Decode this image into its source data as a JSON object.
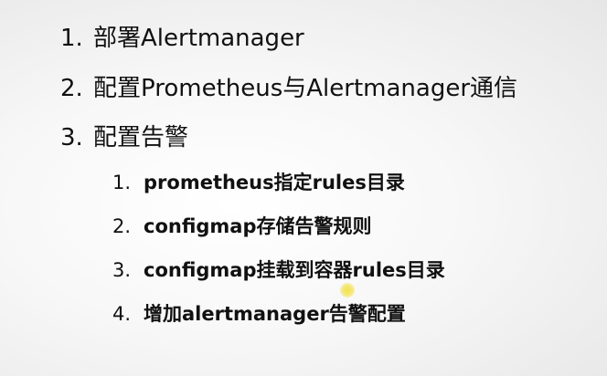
{
  "outline": {
    "items": [
      {
        "number": "1.",
        "text": "部署Alertmanager"
      },
      {
        "number": "2.",
        "text": "配置Prometheus与Alertmanager通信"
      },
      {
        "number": "3.",
        "text": "配置告警"
      }
    ],
    "subitems": [
      {
        "number": "1.",
        "text": "prometheus指定rules目录"
      },
      {
        "number": "2.",
        "text": "configmap存储告警规则"
      },
      {
        "number": "3.",
        "text": "configmap挂载到容器rules目录"
      },
      {
        "number": "4.",
        "text": "增加alertmanager告警配置"
      }
    ]
  },
  "colors": {
    "text": "#111111",
    "background": "#f7f7f7",
    "cursor_highlight": "#f2e24a"
  }
}
